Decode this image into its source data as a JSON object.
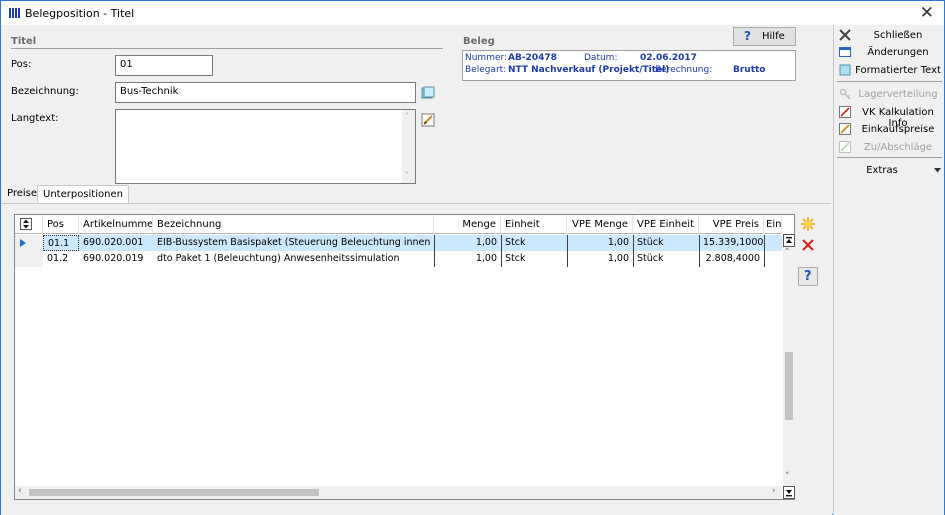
{
  "window": {
    "title": "Belegposition - Titel",
    "close": "✕"
  },
  "titel": {
    "section_label": "Titel",
    "pos_label": "Pos:",
    "pos_value": "01",
    "bezeichnung_label": "Bezeichnung:",
    "bezeichnung_value": "Bus-Technik",
    "langtext_label": "Langtext:",
    "langtext_value": ""
  },
  "beleg": {
    "section_label": "Beleg",
    "nummer_label": "Nummer:",
    "nummer_value": "AB-20478",
    "datum_label": "Datum:",
    "datum_value": "02.06.2017",
    "belegart_label": "Belegart:",
    "belegart_value": "NTT Nachverkauf (Projekt/Titel)",
    "berechnung_label": "Berechnung:",
    "berechnung_value": "Brutto"
  },
  "hilfe": {
    "icon": "?",
    "label": "Hilfe"
  },
  "tabs": [
    {
      "label": "Preise",
      "active": false
    },
    {
      "label": "Unterpositionen",
      "active": true
    }
  ],
  "grid": {
    "columns": [
      "Pos",
      "Artikelnummer",
      "Bezeichnung",
      "Menge",
      "Einheit",
      "VPE Menge",
      "VPE Einheit",
      "VPE Preis",
      "Einz"
    ],
    "rows": [
      {
        "pos": "01.1",
        "artikelnummer": "690.020.001",
        "bezeichnung": "EIB-Bussystem  Basispaket (Steuerung Beleuchtung innen außen, P",
        "menge": "1,00",
        "einheit": "Stck",
        "vpe_menge": "1,00",
        "vpe_einheit": "Stück",
        "vpe_preis": "15.339,1000"
      },
      {
        "pos": "01.2",
        "artikelnummer": "690.020.019",
        "bezeichnung": "dto Paket 1 (Beleuchtung) Anwesenheitssimulation",
        "menge": "1,00",
        "einheit": "Stck",
        "vpe_menge": "1,00",
        "vpe_einheit": "Stück",
        "vpe_preis": "2.808,4000"
      }
    ]
  },
  "right_panel": {
    "items": [
      {
        "label": "Schließen",
        "icon": "close-icon",
        "disabled": false
      },
      {
        "label": "Änderungen",
        "icon": "window-icon",
        "disabled": false
      },
      {
        "label": "Formatierter Text",
        "icon": "document-icon",
        "disabled": false
      },
      {
        "label": "Lagerverteilung",
        "icon": "key-icon",
        "disabled": true
      },
      {
        "label": "VK Kalkulation Info",
        "icon": "calc-icon",
        "disabled": false
      },
      {
        "label": "Einkaufspreise",
        "icon": "edit-icon",
        "disabled": false
      },
      {
        "label": "Zu/Abschläge",
        "icon": "edit-icon",
        "disabled": true
      }
    ],
    "extras_label": "Extras"
  },
  "colors": {
    "accent": "#2b79d0",
    "selection": "#cce8ff",
    "beleg_text": "#1c3aa8"
  }
}
